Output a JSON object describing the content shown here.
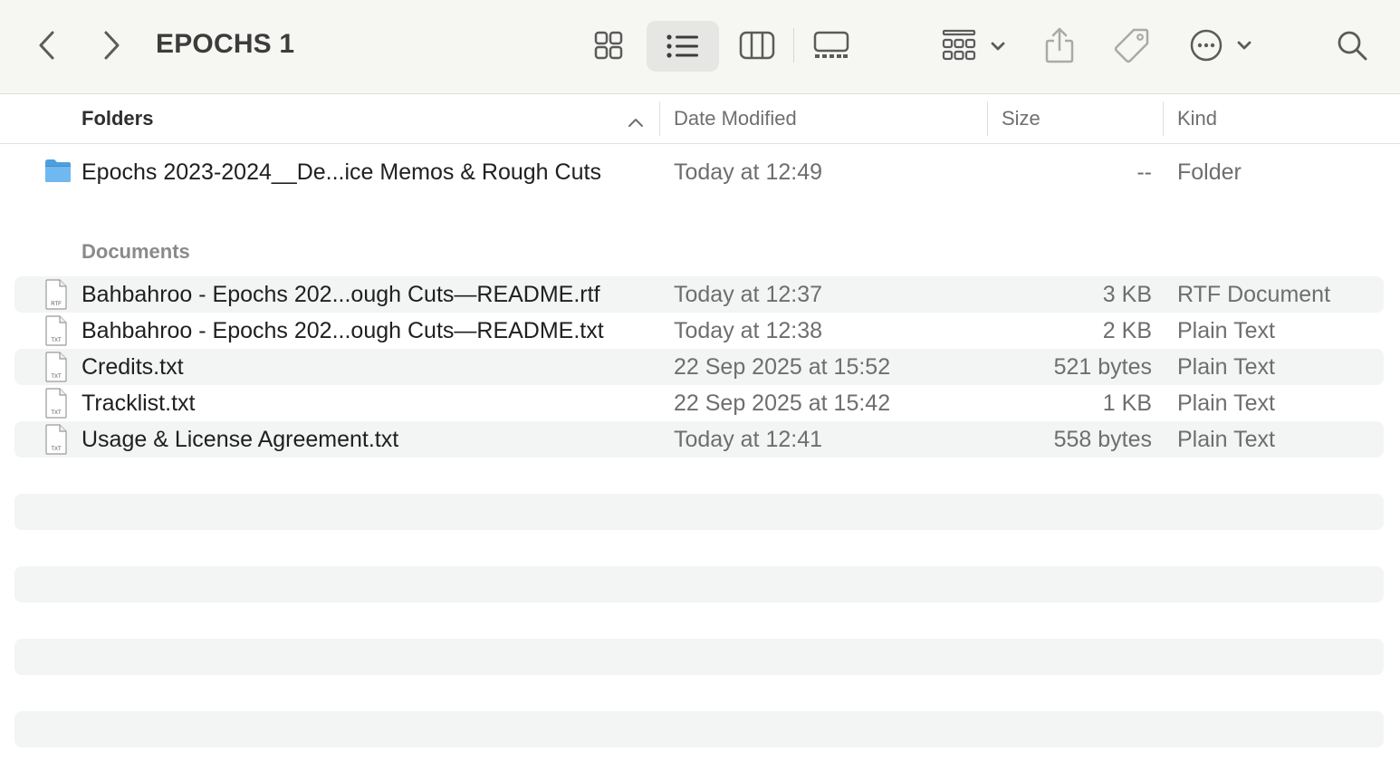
{
  "window": {
    "title": "EPOCHS 1"
  },
  "toolbar": {
    "back_icon": "chevron-left-icon",
    "forward_icon": "chevron-right-icon",
    "views": [
      "icon-view-icon",
      "list-view-icon",
      "column-view-icon",
      "gallery-view-icon"
    ],
    "active_view": "list-view-icon",
    "group_icon": "group-by-icon",
    "share_icon": "share-icon",
    "tag_icon": "tag-icon",
    "more_icon": "ellipsis-circle-icon",
    "search_icon": "search-icon"
  },
  "columns": {
    "name": "Folders",
    "date": "Date Modified",
    "size": "Size",
    "kind": "Kind"
  },
  "folders": [
    {
      "name": "Epochs 2023-2024__De...ice Memos & Rough Cuts",
      "date": "Today at 12:49",
      "size": "--",
      "kind": "Folder",
      "icon": "folder-icon"
    }
  ],
  "documents_label": "Documents",
  "documents": [
    {
      "name": "Bahbahroo - Epochs 202...ough Cuts—README.rtf",
      "date": "Today at 12:37",
      "size": "3 KB",
      "kind": "RTF Document",
      "icon": "rtf-file-icon",
      "badge": "RTF"
    },
    {
      "name": "Bahbahroo - Epochs 202...ough Cuts—README.txt",
      "date": "Today at 12:38",
      "size": "2 KB",
      "kind": "Plain Text",
      "icon": "txt-file-icon",
      "badge": "TXT"
    },
    {
      "name": "Credits.txt",
      "date": "22 Sep 2025 at 15:52",
      "size": "521 bytes",
      "kind": "Plain Text",
      "icon": "txt-file-icon",
      "badge": "TXT"
    },
    {
      "name": "Tracklist.txt",
      "date": "22 Sep 2025 at 15:42",
      "size": "1 KB",
      "kind": "Plain Text",
      "icon": "txt-file-icon",
      "badge": "TXT"
    },
    {
      "name": "Usage & License Agreement.txt",
      "date": "Today at 12:41",
      "size": "558 bytes",
      "kind": "Plain Text",
      "icon": "txt-file-icon",
      "badge": "TXT"
    }
  ],
  "colors": {
    "toolbar_bg": "#f6f6f3",
    "stripe": "#f3f4f4",
    "folder_blue": "#5aa9e6",
    "active_view_bg": "#e6e6e4"
  }
}
